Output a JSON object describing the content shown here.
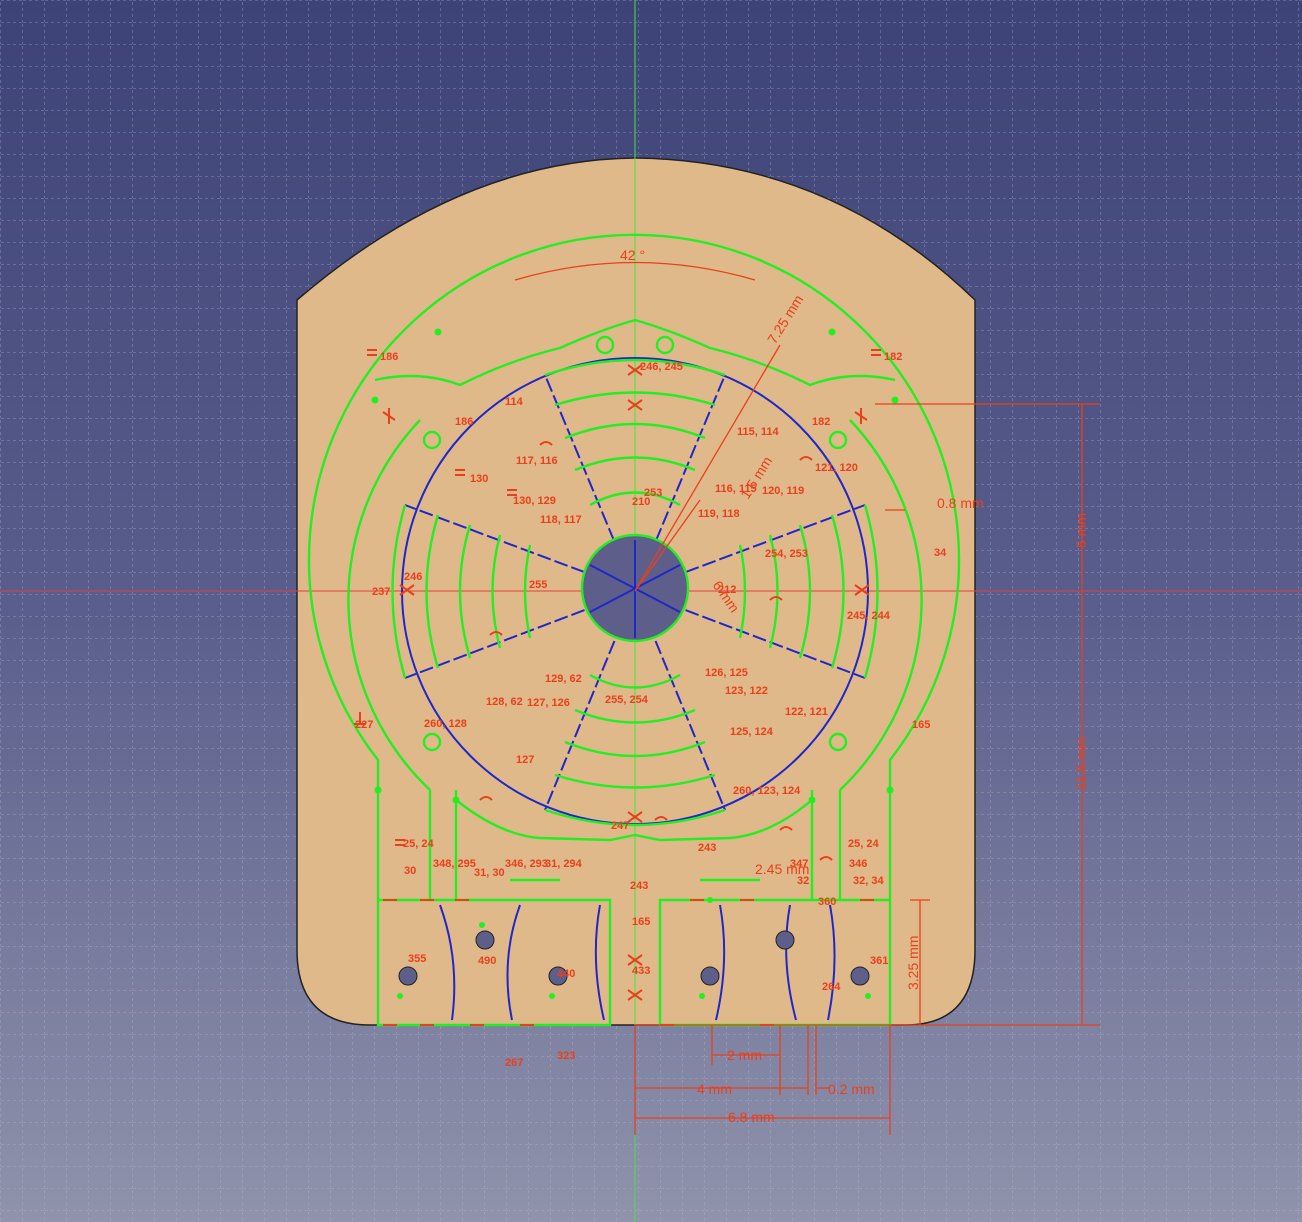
{
  "colors": {
    "background_top": "#3d4277",
    "background_bottom": "#9093ab",
    "part_fill": "#e0b98a",
    "geometry": "#22ee22",
    "construction": "#1f27c9",
    "constraint": "#e8401c",
    "axis_x": "#e84040",
    "axis_y": "#40e840"
  },
  "dimensions": {
    "angle": "42 °",
    "radius_outer": "7.25 mm",
    "radius_mid": "1.5 mm",
    "radius_inner": "6 mm",
    "offset": "0.8 mm",
    "height_top": "5 mm",
    "height_bottom": "11.5 mm",
    "height_slot": "3.25 mm",
    "pitch": "2.45 mm",
    "w2": "2 mm",
    "w4": "4 mm",
    "w02": "0.2 mm",
    "w68": "6.8 mm"
  },
  "constraints": {
    "c186a": "186",
    "c182a": "182",
    "c246_245": "246, 245",
    "c114": "114",
    "c186b": "186",
    "c115_114": "115, 114",
    "c182b": "182",
    "c117_116": "117, 116",
    "c130": "130",
    "c121_120": "121, 120",
    "c130_129": "130, 129",
    "c253": "253",
    "c210": "210",
    "c116_115": "116, 115",
    "c120_119": "120, 119",
    "c118_117": "118, 117",
    "c119_118": "119, 118",
    "c34": "34",
    "c254_253": "254, 253",
    "c246": "246",
    "c237": "237",
    "c255": "255",
    "c212": "212",
    "c245_244": "245, 244",
    "c129_62": "129, 62",
    "c126_125": "126, 125",
    "c123_122": "123, 122",
    "c128_62": "128, 62",
    "c127_126": "127, 126",
    "c255_254": "255, 254",
    "c122_121": "122, 121",
    "c227": "227",
    "c260_128": "260, 128",
    "c165a": "165",
    "c125_124": "125, 124",
    "c127": "127",
    "c260_123_124": "260, 123, 124",
    "c247": "247",
    "c25_24a": "25, 24",
    "c243a": "243",
    "c25_24b": "25, 24",
    "c348_295": "348, 295",
    "c346_293": "346, 293",
    "c31_294": "31, 294",
    "c347": "347",
    "c346": "346",
    "c30": "30",
    "c31_30": "31, 30",
    "c32": "32",
    "c32_34": "32, 34",
    "c243b": "243",
    "c165b": "165",
    "c433": "433",
    "c267": "267",
    "c323": "323",
    "c361": "361",
    "c360": "360",
    "c355": "355",
    "c490": "490",
    "c440": "440",
    "c264": "264"
  }
}
